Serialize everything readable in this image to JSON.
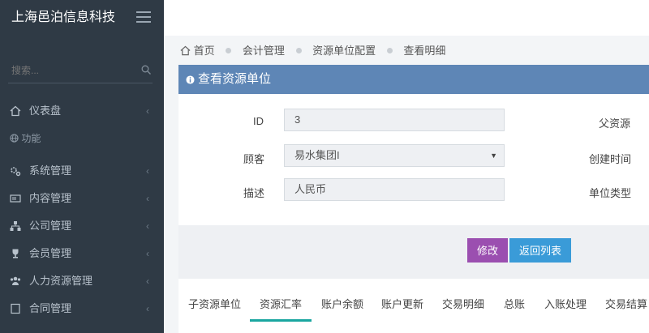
{
  "brand": {
    "title": "上海邑泊信息科技"
  },
  "sidebar": {
    "search_placeholder": "搜索...",
    "section_label": "功能",
    "items": [
      {
        "label": "仪表盘",
        "icon": "home-icon"
      },
      {
        "label": "系统管理",
        "icon": "gears-icon"
      },
      {
        "label": "内容管理",
        "icon": "content-icon"
      },
      {
        "label": "公司管理",
        "icon": "org-icon"
      },
      {
        "label": "会员管理",
        "icon": "trophy-icon"
      },
      {
        "label": "人力资源管理",
        "icon": "users-icon"
      },
      {
        "label": "合同管理",
        "icon": "contract-icon"
      }
    ],
    "chevron": "‹"
  },
  "breadcrumb": {
    "items": [
      "首页",
      "会计管理",
      "资源单位配置",
      "查看明细"
    ]
  },
  "panel": {
    "title": "查看资源单位"
  },
  "form": {
    "id_label": "ID",
    "id_value": "3",
    "customer_label": "顾客",
    "customer_value": "易水集团I",
    "desc_label": "描述",
    "desc_value": "人民币",
    "parent_label": "父资源",
    "created_label": "创建时间",
    "unit_type_label": "单位类型"
  },
  "actions": {
    "edit": "修改",
    "back": "返回列表"
  },
  "tabs": [
    "子资源单位",
    "资源汇率",
    "账户余额",
    "账户更新",
    "交易明细",
    "总账",
    "入账处理",
    "交易结算"
  ],
  "active_tab": "资源汇率",
  "colors": {
    "sidebar": "#2f3a45",
    "header": "#5e86b6",
    "edit": "#9b4fb0",
    "back": "#3a9bd8",
    "tab_active": "#1aa6a0"
  }
}
